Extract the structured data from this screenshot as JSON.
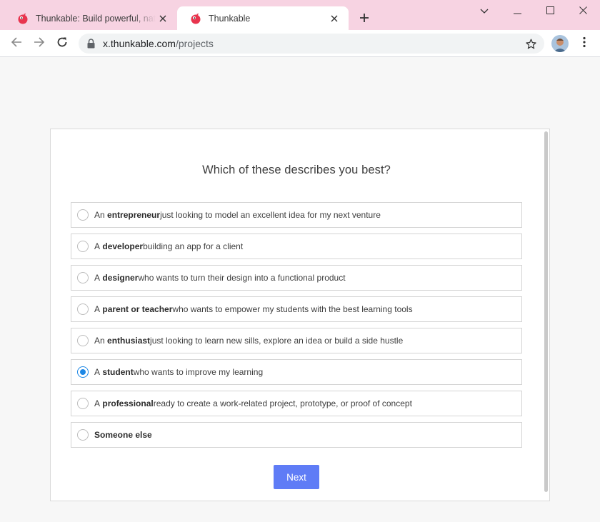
{
  "tabs": [
    {
      "title": "Thunkable: Build powerful, native",
      "active": false
    },
    {
      "title": "Thunkable",
      "active": true
    }
  ],
  "address_bar": {
    "host": "x.thunkable.com",
    "path": "/projects"
  },
  "survey": {
    "question": "Which of these describes you best?",
    "options": [
      {
        "prefix": "An ",
        "role": "entrepreneur",
        "suffix": " just looking to model an excellent idea for my next venture",
        "selected": false
      },
      {
        "prefix": "A ",
        "role": "developer",
        "suffix": " building an app for a client",
        "selected": false
      },
      {
        "prefix": "A ",
        "role": "designer",
        "suffix": " who wants to turn their design into a functional product",
        "selected": false
      },
      {
        "prefix": "A ",
        "role": "parent or teacher",
        "suffix": " who wants to empower my students with the best learning tools",
        "selected": false
      },
      {
        "prefix": "An ",
        "role": "enthusiast",
        "suffix": " just looking to learn new sills, explore an idea or build a side hustle",
        "selected": false
      },
      {
        "prefix": "A ",
        "role": "student",
        "suffix": " who wants to improve my learning",
        "selected": true
      },
      {
        "prefix": "A ",
        "role": "professional",
        "suffix": " ready to create a work-related project, prototype, or proof of concept",
        "selected": false
      },
      {
        "prefix": "",
        "role": "Someone else",
        "suffix": "",
        "selected": false
      }
    ],
    "next_label": "Next"
  },
  "colors": {
    "tabstrip": "#f7d3e2",
    "accent_button": "#5f7cf6",
    "radio_selected": "#1e88e5"
  },
  "icons": [
    "thunkable-favicon",
    "close-icon",
    "plus-icon",
    "chevron-down-icon",
    "minimize-icon",
    "maximize-icon",
    "back-arrow-icon",
    "forward-arrow-icon",
    "reload-icon",
    "lock-icon",
    "star-icon",
    "kebab-menu-icon"
  ]
}
